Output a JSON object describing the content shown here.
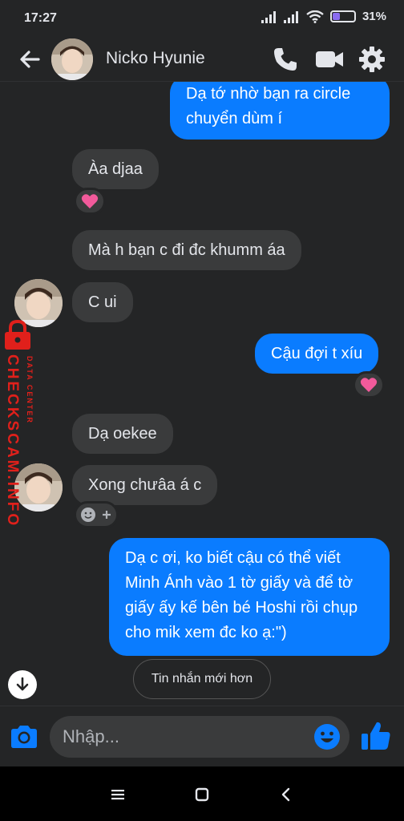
{
  "status_bar": {
    "time": "17:27",
    "battery_percent": "31%",
    "battery_level": 0.31,
    "battery_color": "#8a6cf0"
  },
  "header": {
    "contact_name": "Nicko Hyunie",
    "icons": [
      "back-arrow-icon",
      "phone-icon",
      "video-camera-icon",
      "gear-icon"
    ]
  },
  "messages": [
    {
      "side": "out",
      "text": "Dạ tớ nhờ bạn ra circle\nchuyển dùm í"
    },
    {
      "side": "in",
      "text": "Àa djaa",
      "reaction": "heart"
    },
    {
      "side": "in",
      "text": "Mà h bạn c đi đc khumm áa"
    },
    {
      "side": "in",
      "text": "C ui"
    },
    {
      "side": "out",
      "text": "Cậu đợi t xíu",
      "reaction": "heart"
    },
    {
      "side": "in",
      "text": "Dạ oekee"
    },
    {
      "side": "in",
      "text": "Xong chưâa á c",
      "reaction": "add-reaction"
    },
    {
      "side": "out",
      "text": "Dạ c ơi, ko biết cậu có thể viết Minh Ánh vào 1 tờ giấy và để tờ giấy ấy kế bên bé Hoshi rồi chụp cho mik xem đc ko ạ:\")"
    }
  ],
  "watermark": {
    "brand": "CHECKSCAM.INFO",
    "tagline": "DATA CENTER",
    "color": "#e0201b"
  },
  "newer_messages_button": "Tin nhắn mới hơn",
  "composer": {
    "placeholder": "Nhập...",
    "icons": [
      "camera-icon",
      "emoji-icon",
      "thumbs-up-icon"
    ]
  },
  "colors": {
    "background": "#242526",
    "incoming_bubble": "#3a3b3c",
    "outgoing_bubble": "#0a7cff",
    "accent": "#0a7cff"
  }
}
